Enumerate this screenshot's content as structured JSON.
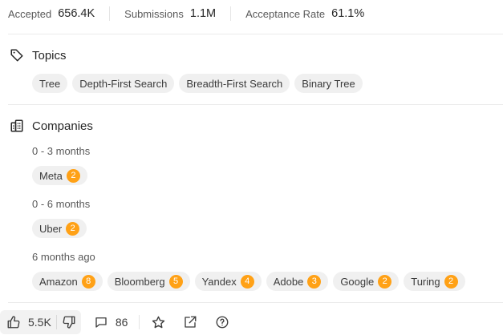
{
  "stats": {
    "accepted_label": "Accepted",
    "accepted_value": "656.4K",
    "submissions_label": "Submissions",
    "submissions_value": "1.1M",
    "acceptance_label": "Acceptance Rate",
    "acceptance_value": "61.1%"
  },
  "topics": {
    "title": "Topics",
    "icon": "tag-icon",
    "tags": [
      "Tree",
      "Depth-First Search",
      "Breadth-First Search",
      "Binary Tree"
    ]
  },
  "companies": {
    "title": "Companies",
    "icon": "building-icon",
    "groups": [
      {
        "period": "0 - 3 months",
        "items": [
          {
            "name": "Meta",
            "count": "2"
          }
        ]
      },
      {
        "period": "0 - 6 months",
        "items": [
          {
            "name": "Uber",
            "count": "2"
          }
        ]
      },
      {
        "period": "6 months ago",
        "items": [
          {
            "name": "Amazon",
            "count": "8"
          },
          {
            "name": "Bloomberg",
            "count": "5"
          },
          {
            "name": "Yandex",
            "count": "4"
          },
          {
            "name": "Adobe",
            "count": "3"
          },
          {
            "name": "Google",
            "count": "2"
          },
          {
            "name": "Turing",
            "count": "2"
          }
        ]
      }
    ]
  },
  "footer": {
    "likes": "5.5K",
    "comments": "86",
    "icons": [
      "thumbs-up-icon",
      "thumbs-down-icon",
      "comment-icon",
      "star-icon",
      "share-icon",
      "help-icon"
    ]
  },
  "colors": {
    "badge": "#ffa116",
    "chip_bg": "#f0f0f0",
    "text": "#262626",
    "muted": "#595959"
  }
}
